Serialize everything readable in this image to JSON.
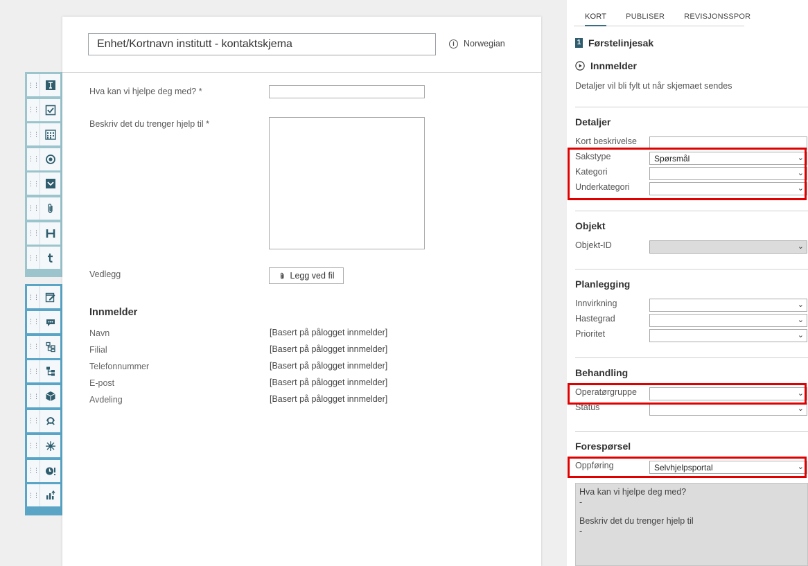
{
  "toolbox": {
    "group1": [
      {
        "icon": "text-field-icon"
      },
      {
        "icon": "checkbox-icon"
      },
      {
        "icon": "calendar-icon"
      },
      {
        "icon": "radio-button-icon"
      },
      {
        "icon": "dropdown-icon"
      },
      {
        "icon": "attachment-icon"
      },
      {
        "icon": "heading-icon"
      },
      {
        "icon": "text-icon"
      }
    ],
    "group2": [
      {
        "icon": "note-edit-icon"
      },
      {
        "icon": "chat-icon"
      },
      {
        "icon": "hierarchy-icon"
      },
      {
        "icon": "tree-icon"
      },
      {
        "icon": "cube-icon"
      },
      {
        "icon": "support-agent-icon"
      },
      {
        "icon": "burst-icon"
      },
      {
        "icon": "clock-alert-icon"
      },
      {
        "icon": "chart-icon"
      }
    ]
  },
  "canvas": {
    "title": "Enhet/Kortnavn institutt - kontaktskjema",
    "language": "Norwegian",
    "fields": {
      "help_label": "Hva kan vi hjelpe deg med? *",
      "describe_label": "Beskriv det du trenger hjelp til *",
      "attachment_label": "Vedlegg",
      "attach_button": "Legg ved fil"
    },
    "reporter": {
      "heading": "Innmelder",
      "rows": [
        {
          "label": "Navn",
          "value": "[Basert på pålogget innmelder]"
        },
        {
          "label": "Filial",
          "value": "[Basert på pålogget innmelder]"
        },
        {
          "label": "Telefonnummer",
          "value": "[Basert på pålogget innmelder]"
        },
        {
          "label": "E-post",
          "value": "[Basert på pålogget innmelder]"
        },
        {
          "label": "Avdeling",
          "value": "[Basert på pålogget innmelder]"
        }
      ]
    }
  },
  "panel": {
    "tabs": [
      "KORT",
      "PUBLISER",
      "REVISJONSSPOR"
    ],
    "badge": "1",
    "card_type": "Førstelinjesak",
    "reporter_heading": "Innmelder",
    "reporter_note": "Detaljer vil bli fylt ut når skjemaet sendes",
    "details": {
      "heading": "Detaljer",
      "short_desc_label": "Kort beskrivelse",
      "case_type_label": "Sakstype",
      "case_type_value": "Spørsmål",
      "category_label": "Kategori",
      "subcategory_label": "Underkategori"
    },
    "object": {
      "heading": "Objekt",
      "object_id_label": "Objekt-ID"
    },
    "planning": {
      "heading": "Planlegging",
      "impact_label": "Innvirkning",
      "urgency_label": "Hastegrad",
      "priority_label": "Prioritet"
    },
    "handling": {
      "heading": "Behandling",
      "operator_group_label": "Operatørgruppe",
      "status_label": "Status"
    },
    "request": {
      "heading": "Forespørsel",
      "entry_label": "Oppføring",
      "entry_value": "Selvhjelpsportal",
      "summary_q1": "Hva kan vi hjelpe deg med?",
      "summary_a1": "-",
      "summary_q2": "Beskriv det du trenger hjelp til",
      "summary_a2": "-"
    }
  },
  "colors": {
    "highlight": "#e00000",
    "toolbox_group1": "#9bc4cc",
    "toolbox_group2": "#5aa4c6",
    "icon_dark": "#2f5d6e"
  }
}
